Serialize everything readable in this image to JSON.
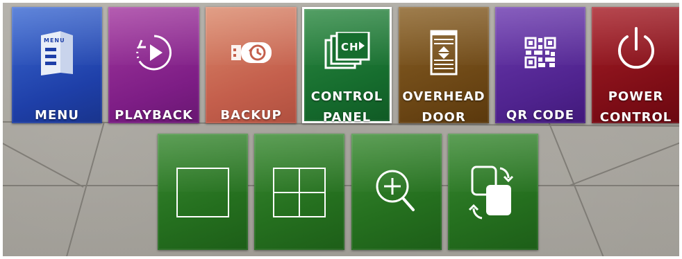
{
  "top_row": [
    {
      "id": "menu",
      "label": "MENU",
      "icon": "menu-book-icon",
      "color": "#2a4fbe"
    },
    {
      "id": "playback",
      "label": "PLAYBACK",
      "icon": "playback-icon",
      "color": "#8c2690"
    },
    {
      "id": "backup",
      "label": "BACKUP",
      "icon": "usb-backup-icon",
      "color": "#cd6e57"
    },
    {
      "id": "control_panel",
      "label_line1": "CONTROL",
      "label_line2": "PANEL",
      "icon": "channel-panel-icon",
      "color": "#1b7432",
      "selected": true,
      "glyph_text": "CH"
    },
    {
      "id": "overhead_door",
      "label_line1": "OVERHEAD",
      "label_line2": "DOOR",
      "icon": "overhead-door-icon",
      "color": "#74501b"
    },
    {
      "id": "qr_code",
      "label": "QR CODE",
      "icon": "qr-code-icon",
      "color": "#5a2b9c"
    },
    {
      "id": "power_control",
      "label_line1": "POWER",
      "label_line2": "CONTROL",
      "icon": "power-icon",
      "color": "#8e1119"
    }
  ],
  "bottom_row": [
    {
      "id": "single_view",
      "icon": "single-view-icon"
    },
    {
      "id": "quad_view",
      "icon": "quad-view-icon"
    },
    {
      "id": "zoom",
      "icon": "zoom-in-icon"
    },
    {
      "id": "swap",
      "icon": "swap-icon"
    }
  ],
  "theme": {
    "bottom_tile_color": "#2a7a24",
    "selected_border": "#ffffff"
  }
}
